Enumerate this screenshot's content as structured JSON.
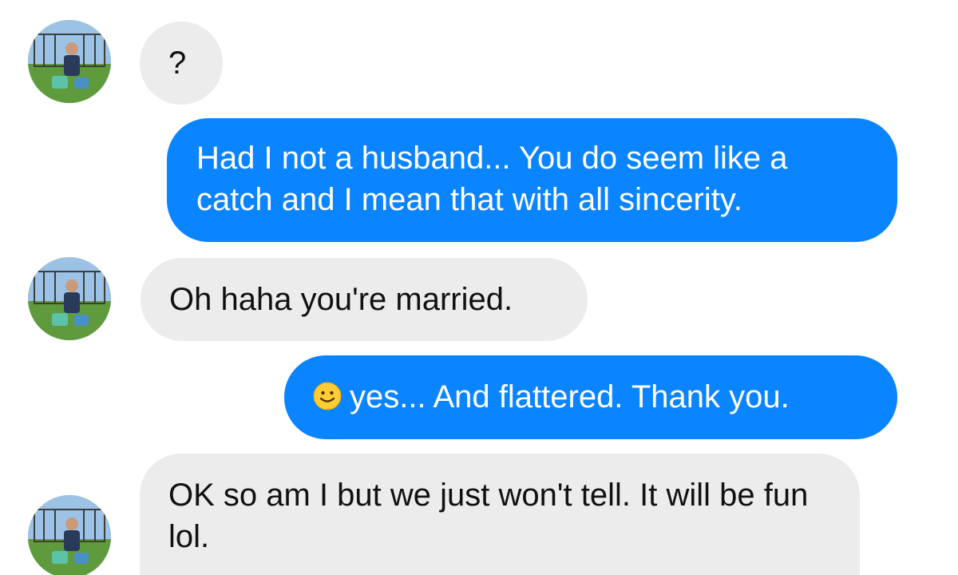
{
  "messages": [
    {
      "side": "in",
      "text": "?"
    },
    {
      "side": "out",
      "text": "Had I not a husband... You do seem like a catch and I mean that with all sincerity."
    },
    {
      "side": "in",
      "text": "Oh haha you're married."
    },
    {
      "side": "out",
      "emoji": "slightly-smiling-face-icon",
      "text": "yes... And flattered. Thank you."
    },
    {
      "side": "in",
      "text": "OK so am I but we just won't tell. It will be fun lol."
    }
  ],
  "colors": {
    "outgoing_bubble": "#0a84ff",
    "incoming_bubble": "#ececec",
    "background": "#ffffff"
  }
}
